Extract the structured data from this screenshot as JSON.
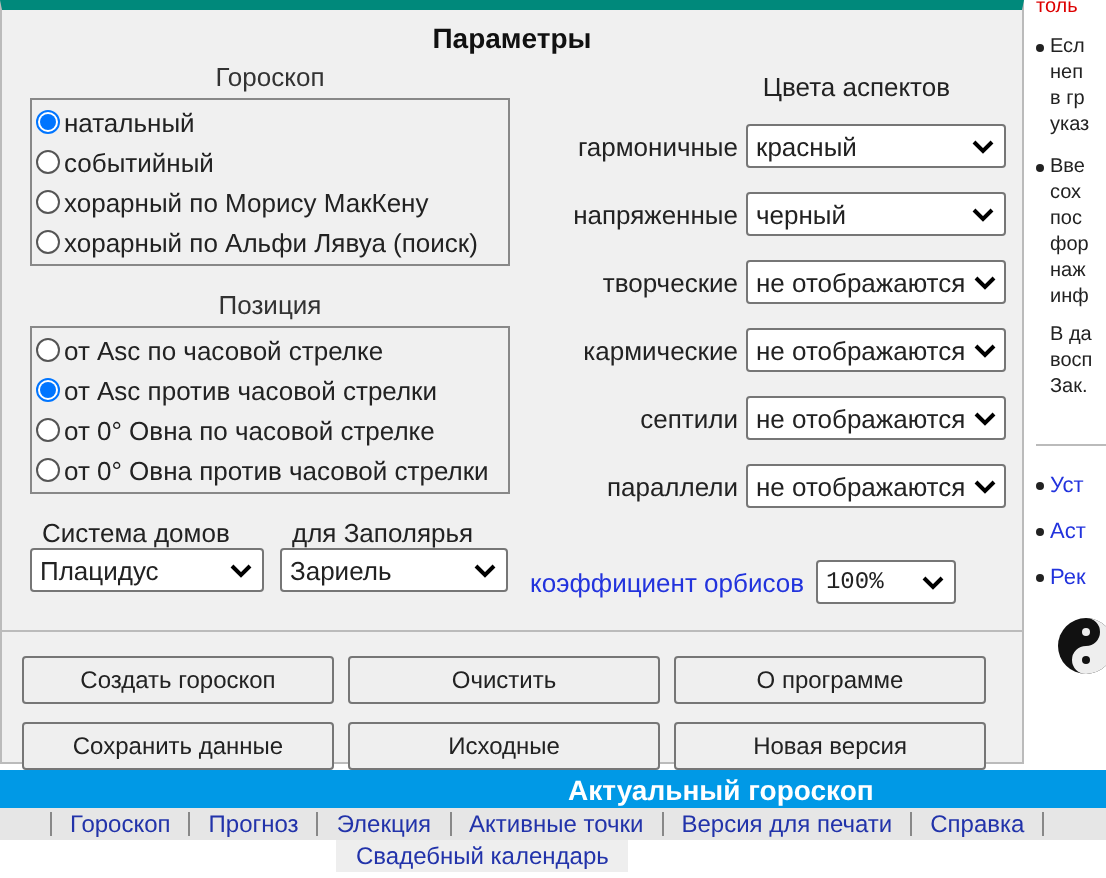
{
  "panel": {
    "title": "Параметры",
    "horoscope": {
      "label": "Гороскоп",
      "options": [
        {
          "label": "натальный",
          "selected": true
        },
        {
          "label": "событийный",
          "selected": false
        },
        {
          "label": "хорарный по Морису МакКену",
          "selected": false
        },
        {
          "label": "хорарный по Альфи Лявуа (поиск)",
          "selected": false
        }
      ]
    },
    "position": {
      "label": "Позиция",
      "options": [
        {
          "label": "от Asc по часовой стрелке",
          "selected": false
        },
        {
          "label": "от Asc против часовой стрелки",
          "selected": true
        },
        {
          "label": "от 0° Овна по часовой стрелке",
          "selected": false
        },
        {
          "label": "от 0° Овна против часовой стрелки",
          "selected": false
        }
      ]
    },
    "house_system": {
      "label": "Система домов",
      "value": "Плацидус"
    },
    "polar": {
      "label": "для Заполярья",
      "value": "Зариель"
    },
    "aspect_colors": {
      "label": "Цвета аспектов",
      "rows": [
        {
          "label": "гармоничные",
          "value": "красный"
        },
        {
          "label": "напряженные",
          "value": "черный"
        },
        {
          "label": "творческие",
          "value": "не отображаются"
        },
        {
          "label": "кармические",
          "value": "не отображаются"
        },
        {
          "label": "септили",
          "value": "не отображаются"
        },
        {
          "label": "параллели",
          "value": "не отображаются"
        }
      ]
    },
    "orbis": {
      "label": "коэффициент орбисов",
      "value": "100%"
    },
    "buttons": [
      "Создать гороскоп",
      "Очистить",
      "О программе",
      "Сохранить данные",
      "Исходные",
      "Новая версия"
    ]
  },
  "sidebar": {
    "top_text": "толь",
    "notes": [
      [
        "Есл",
        "неп",
        "в гр",
        "указ"
      ],
      [
        "Вве",
        "сох",
        "пос",
        "фор",
        "наж",
        "инф"
      ],
      [
        "В да",
        "восп",
        "Зак."
      ]
    ],
    "links": [
      "Уст",
      "Аст",
      "Рек"
    ]
  },
  "banner": {
    "title": "Актуальный гороскоп"
  },
  "nav": {
    "links": [
      "Гороскоп",
      "Прогноз",
      "Элекция",
      "Активные точки",
      "Версия для печати",
      "Справка"
    ],
    "second_row": [
      "Свадебный календарь"
    ]
  }
}
